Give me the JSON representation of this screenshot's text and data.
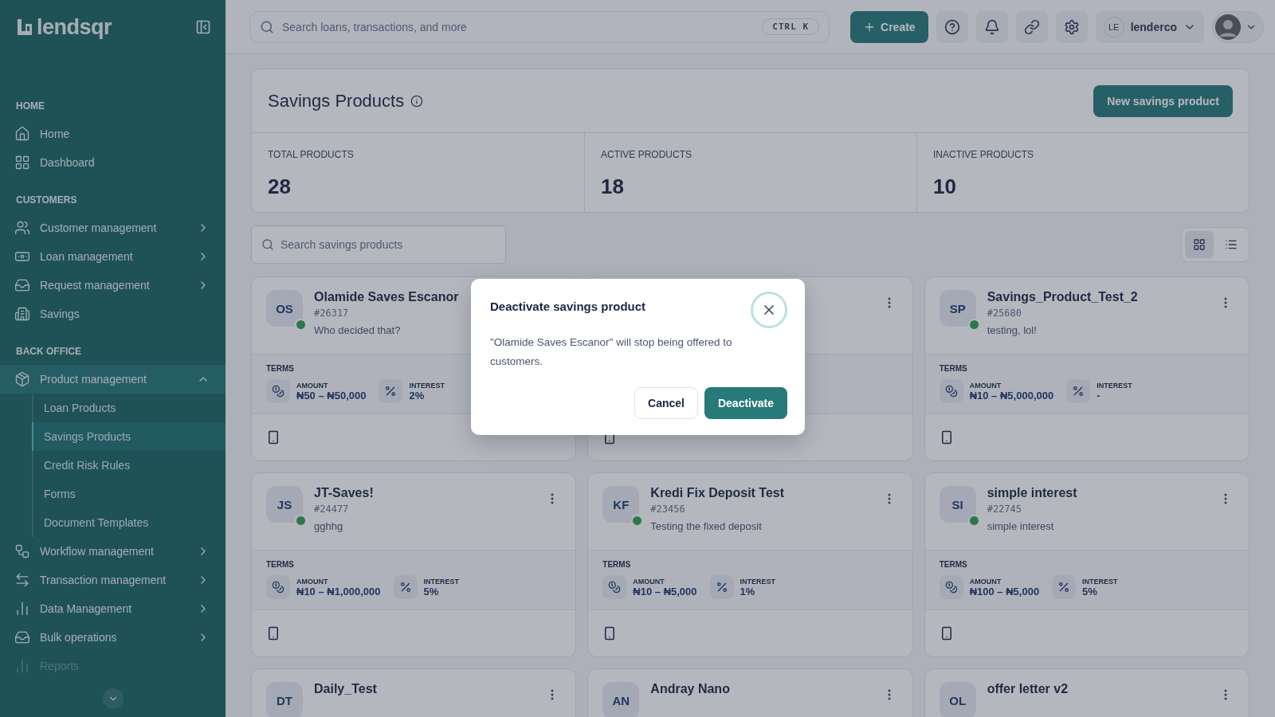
{
  "sidebar": {
    "logo": "lendsqr",
    "sections": [
      {
        "heading": "HOME",
        "items": [
          {
            "label": "Home",
            "selected": false,
            "expandable": false,
            "disabled": false
          },
          {
            "label": "Dashboard",
            "selected": false,
            "expandable": false,
            "disabled": false
          }
        ]
      },
      {
        "heading": "CUSTOMERS",
        "items": [
          {
            "label": "Customer management",
            "selected": false,
            "expandable": true,
            "disabled": false
          },
          {
            "label": "Loan management",
            "selected": false,
            "expandable": true,
            "disabled": false
          },
          {
            "label": "Request management",
            "selected": false,
            "expandable": true,
            "disabled": false
          },
          {
            "label": "Savings",
            "selected": false,
            "expandable": false,
            "disabled": false
          }
        ]
      },
      {
        "heading": "BACK OFFICE",
        "items": [
          {
            "label": "Product management",
            "selected": true,
            "expandable": true,
            "expanded": true,
            "disabled": false,
            "children": [
              {
                "label": "Loan Products",
                "selected": false
              },
              {
                "label": "Savings Products",
                "selected": true
              },
              {
                "label": "Credit Risk Rules",
                "selected": false
              },
              {
                "label": "Forms",
                "selected": false
              },
              {
                "label": "Document Templates",
                "selected": false
              }
            ]
          },
          {
            "label": "Workflow management",
            "selected": false,
            "expandable": true,
            "disabled": false
          },
          {
            "label": "Transaction management",
            "selected": false,
            "expandable": true,
            "disabled": false
          },
          {
            "label": "Data Management",
            "selected": false,
            "expandable": true,
            "disabled": false
          },
          {
            "label": "Bulk operations",
            "selected": false,
            "expandable": true,
            "disabled": false
          },
          {
            "label": "Reports",
            "selected": false,
            "expandable": false,
            "disabled": true
          }
        ]
      }
    ]
  },
  "topbar": {
    "search_placeholder": "Search loans, transactions, and more",
    "shortcut": "CTRL K",
    "create": "Create",
    "user_initials": "LE",
    "user_name": "lenderco"
  },
  "page": {
    "title": "Savings Products",
    "new_button": "New savings product",
    "stats": [
      {
        "label": "TOTAL PRODUCTS",
        "value": "28"
      },
      {
        "label": "ACTIVE PRODUCTS",
        "value": "18"
      },
      {
        "label": "INACTIVE PRODUCTS",
        "value": "10"
      }
    ],
    "search_placeholder": "Search savings products",
    "views": [
      {
        "selected": true
      },
      {
        "selected": false
      }
    ],
    "cards": [
      {
        "kind": "full",
        "menu": false,
        "initials": "OS",
        "name": "Olamide Saves Escanor",
        "code": "#26317",
        "description": "Who decided that?",
        "active": true,
        "terms": "TERMS",
        "amount_label": "AMOUNT",
        "amount": "₦50 – ₦50,000",
        "interest_label": "INTEREST",
        "interest": "2%"
      },
      {
        "kind": "covered",
        "menu": true
      },
      {
        "kind": "full",
        "menu": true,
        "initials": "SP",
        "name": "Savings_Product_Test_2",
        "code": "#25680",
        "description": "testing, lol!",
        "active": true,
        "terms": "TERMS",
        "amount_label": "AMOUNT",
        "amount": "₦10 – ₦5,000,000",
        "interest_label": "INTEREST",
        "interest": "-"
      },
      {
        "kind": "full",
        "menu": true,
        "initials": "JS",
        "name": "JT-Saves!",
        "code": "#24477",
        "description": "gghhg",
        "active": true,
        "terms": "TERMS",
        "amount_label": "AMOUNT",
        "amount": "₦10 – ₦1,000,000",
        "interest_label": "INTEREST",
        "interest": "5%"
      },
      {
        "kind": "full",
        "menu": true,
        "initials": "KF",
        "name": "Kredi Fix Deposit Test",
        "code": "#23456",
        "description": "Testing the fixed deposit",
        "active": true,
        "terms": "TERMS",
        "amount_label": "AMOUNT",
        "amount": "₦10 – ₦5,000",
        "interest_label": "INTEREST",
        "interest": "1%"
      },
      {
        "kind": "full",
        "menu": true,
        "initials": "SI",
        "name": "simple interest",
        "code": "#22745",
        "description": "simple interest",
        "active": true,
        "terms": "TERMS",
        "amount_label": "AMOUNT",
        "amount": "₦100 – ₦5,000",
        "interest_label": "INTEREST",
        "interest": "5%"
      },
      {
        "kind": "cut",
        "menu": true,
        "initials": "DT",
        "name": "Daily_Test"
      },
      {
        "kind": "cut",
        "menu": true,
        "initials": "AN",
        "name": "Andray Nano"
      },
      {
        "kind": "cut",
        "menu": true,
        "initials": "OL",
        "name": "offer letter v2"
      }
    ]
  },
  "dialog": {
    "title": "Deactivate savings product",
    "message": "\"Olamide Saves Escanor\" will stop being offered to customers.",
    "cancel": "Cancel",
    "confirm": "Deactivate"
  }
}
